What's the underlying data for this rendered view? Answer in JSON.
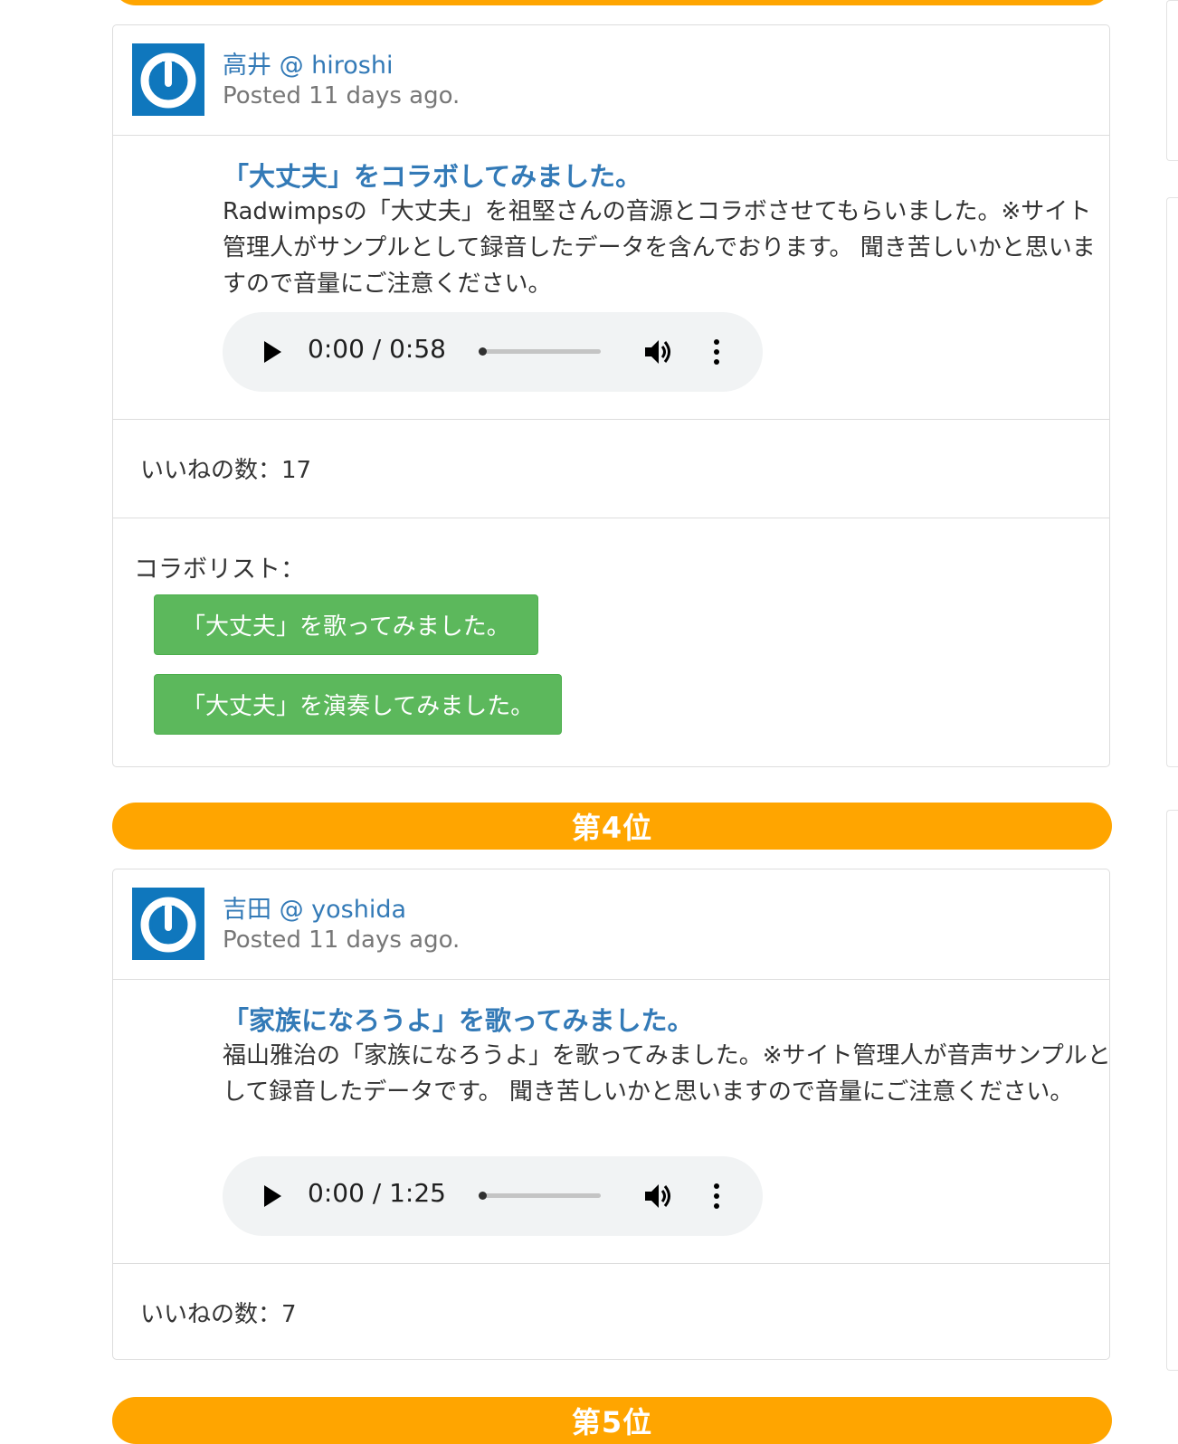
{
  "posts": [
    {
      "user": "高井 @ hiroshi",
      "posted": "Posted 11 days ago.",
      "title": "「大丈夫」をコラボしてみました。",
      "description": "Radwimpsの「大丈夫」を祖堅さんの音源とコラボさせてもらいました。※サイト管理人がサンプルとして録音したデータを含んでおります。 聞き苦しいかと思いますので音量にご注意ください。",
      "audio_time": "0:00 / 0:58",
      "likes": "いいねの数：17",
      "collab_label": "コラボリスト：",
      "collabs": [
        "「大丈夫」を歌ってみました。",
        "「大丈夫」を演奏してみました。"
      ]
    },
    {
      "user": "吉田 @ yoshida",
      "posted": "Posted 11 days ago.",
      "title": "「家族になろうよ」を歌ってみました。",
      "description": "福山雅治の「家族になろうよ」を歌ってみました。※サイト管理人が音声サンプルとして録音したデータです。 聞き苦しいかと思いますので音量にご注意ください。",
      "audio_time": "0:00 / 1:25",
      "likes": "いいねの数：7"
    }
  ],
  "ranks": [
    "第4位",
    "第5位"
  ],
  "colors": {
    "rank_bar": "#ffa500",
    "link": "#337ab7",
    "collab_button": "#5cb85c",
    "avatar": "#0f77bd"
  },
  "icons": [
    "avatar-power-icon",
    "play-icon",
    "volume-icon",
    "more-vert-icon"
  ]
}
